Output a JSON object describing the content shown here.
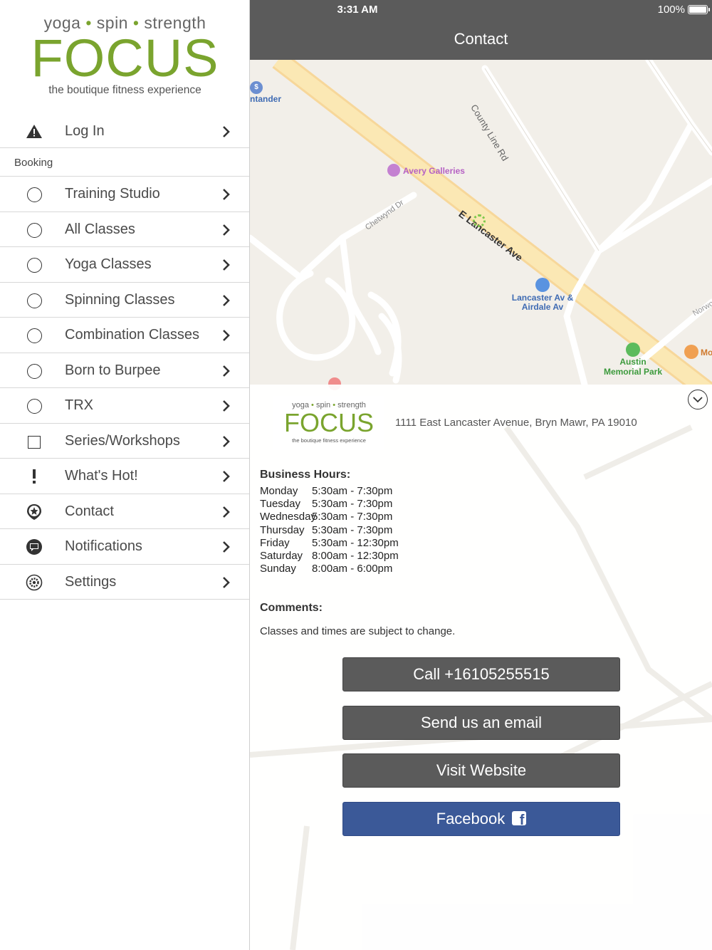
{
  "status_bar": {
    "time": "3:31 AM",
    "battery": "100%"
  },
  "nav": {
    "title": "Contact"
  },
  "brand": {
    "tagline_parts": [
      "yoga",
      "spin",
      "strength"
    ],
    "tagline_separator": "•",
    "wordmark": "FOCUS",
    "subtitle": "the boutique fitness experience",
    "color": "#7aa42e"
  },
  "sidebar": {
    "login": {
      "label": "Log In",
      "icon": "warning-icon"
    },
    "section_label": "Booking",
    "items": [
      {
        "label": "Training Studio",
        "icon": "circle-icon"
      },
      {
        "label": "All Classes",
        "icon": "circle-icon"
      },
      {
        "label": "Yoga Classes",
        "icon": "circle-icon"
      },
      {
        "label": "Spinning Classes",
        "icon": "circle-icon"
      },
      {
        "label": "Combination Classes",
        "icon": "circle-icon"
      },
      {
        "label": "Born to Burpee",
        "icon": "circle-icon"
      },
      {
        "label": "TRX",
        "icon": "circle-icon"
      },
      {
        "label": "Series/Workshops",
        "icon": "square-icon"
      },
      {
        "label": "What's Hot!",
        "icon": "exclamation-icon"
      },
      {
        "label": "Contact",
        "icon": "location-pin-icon"
      },
      {
        "label": "Notifications",
        "icon": "chat-bubble-icon"
      },
      {
        "label": "Settings",
        "icon": "gear-icon"
      }
    ]
  },
  "map": {
    "labels": {
      "bank": "ntander",
      "street_county": "County Line Rd",
      "gallery": "Avery Galleries",
      "street_chetwynd": "Chetwynd Dr",
      "street_lancaster": "E Lancaster Ave",
      "bus_stop": [
        "Lancaster Av &",
        "Airdale Av"
      ],
      "park": [
        "Austin",
        "Memorial Park"
      ],
      "street_norwood": "Norwo",
      "shop": "Mo"
    }
  },
  "contact": {
    "address": "1111 East Lancaster Avenue,  Bryn Mawr, PA  19010",
    "hours_title": "Business Hours:",
    "hours": [
      {
        "day": "Monday",
        "time": "5:30am - 7:30pm"
      },
      {
        "day": "Tuesday",
        "time": "5:30am - 7:30pm"
      },
      {
        "day": "Wednesday",
        "time": "5:30am - 7:30pm"
      },
      {
        "day": "Thursday",
        "time": "5:30am - 7:30pm"
      },
      {
        "day": "Friday",
        "time": "5:30am - 12:30pm"
      },
      {
        "day": "Saturday",
        "time": "8:00am - 12:30pm"
      },
      {
        "day": "Sunday",
        "time": "8:00am - 6:00pm"
      }
    ],
    "comments_title": "Comments:",
    "comments": "Classes and times are subject to change.",
    "buttons": {
      "call": "Call +16105255515",
      "email": "Send us an email",
      "website": "Visit Website",
      "facebook": "Facebook",
      "facebook_icon": "facebook-icon"
    },
    "colors": {
      "button": "#5b5b5b",
      "facebook": "#3b5998",
      "navbar": "#5b5b5b"
    }
  }
}
